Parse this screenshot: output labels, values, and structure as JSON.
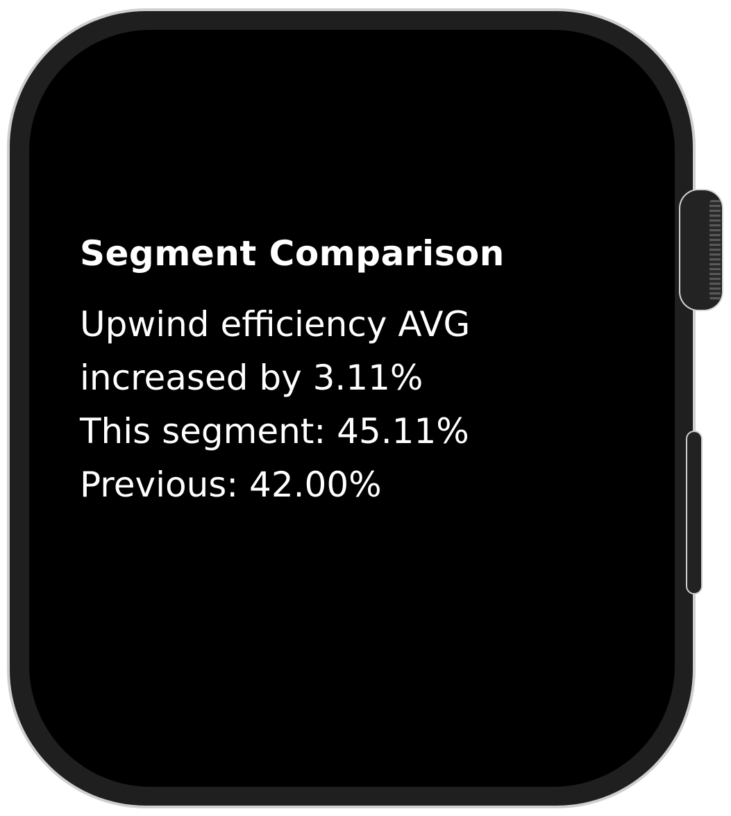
{
  "screen": {
    "title": "Segment Comparison",
    "lines": [
      "Upwind efficiency AVG",
      "increased by 3.11%",
      "This segment: 45.11%",
      "Previous: 42.00%"
    ]
  },
  "colors": {
    "screen_background": "#000000",
    "text": "#ffffff",
    "bezel": "#1f1f1f",
    "case": "#cfcfcf"
  },
  "icons": {
    "crown": "digital-crown-icon",
    "side_button": "side-button"
  }
}
